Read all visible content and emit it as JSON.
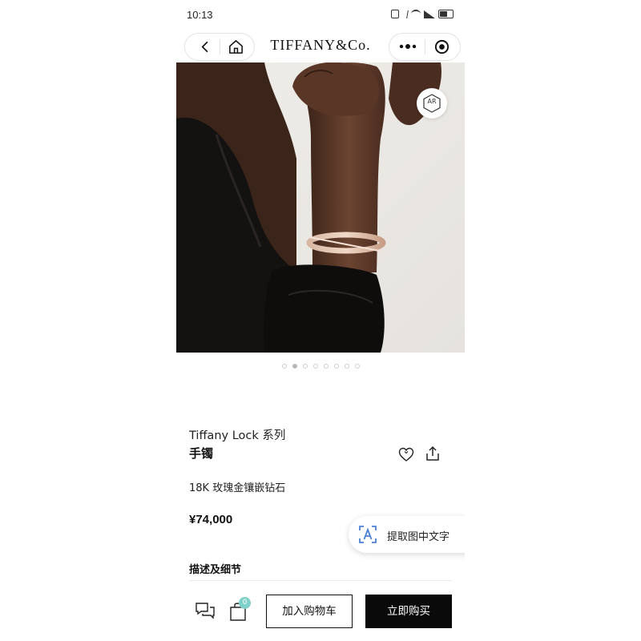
{
  "status_bar": {
    "time": "10:13"
  },
  "nav": {
    "brand": "TIFFANY&Co."
  },
  "hero": {
    "ar_label": "AR",
    "active_index": 1,
    "total": 8
  },
  "product": {
    "collection": "Tiffany Lock 系列",
    "name": "手镯",
    "material": "18K 玫瑰金镶嵌钻石",
    "price": "¥74,000"
  },
  "ocr": {
    "label": "提取图中文字"
  },
  "details": {
    "title": "描述及细节"
  },
  "bottom_bar": {
    "cart_count": "0",
    "add_to_cart": "加入购物车",
    "buy_now": "立即购买"
  },
  "colors": {
    "accent_teal": "#7fd0c8",
    "buy_button": "#0a0a0a"
  }
}
